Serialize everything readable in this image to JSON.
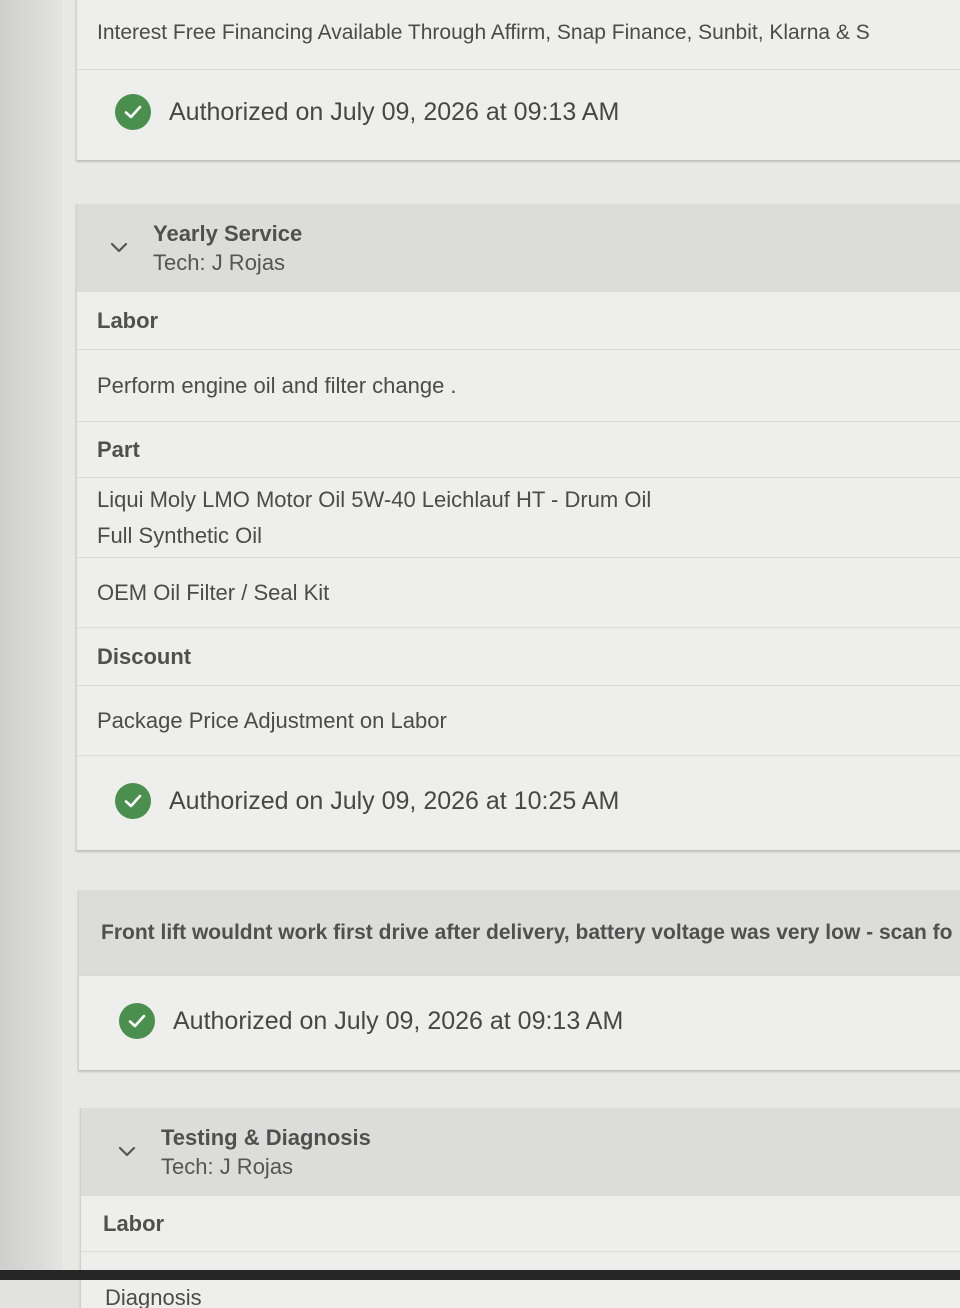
{
  "financing": {
    "text": "Interest Free Financing Available Through   Affirm,  Snap Finance, Sunbit, Klarna & S",
    "authorized": "Authorized on July 09, 2026 at 09:13 AM"
  },
  "yearly_service": {
    "title": "Yearly Service",
    "tech": "Tech: J Rojas",
    "labor_header": "Labor",
    "labor_item": "Perform engine oil and filter change .",
    "part_header": "Part",
    "part_items": [
      {
        "line1": "Liqui Moly LMO Motor Oil 5W-40 Leichlauf HT - Drum Oil",
        "line2": "Full Synthetic Oil"
      },
      {
        "line1": "OEM Oil Filter / Seal Kit"
      }
    ],
    "discount_header": "Discount",
    "discount_item": "Package Price Adjustment on Labor",
    "authorized": "Authorized on July 09, 2026 at 10:25 AM"
  },
  "front_lift": {
    "text": "Front lift wouldnt work first drive after delivery, battery voltage was very low - scan fo",
    "authorized": "Authorized on July 09, 2026 at 09:13 AM"
  },
  "testing_diagnosis": {
    "title": "Testing & Diagnosis",
    "tech": "Tech: J Rojas",
    "labor_header": "Labor",
    "next_item_partial": "Diagnosis"
  },
  "colors": {
    "check_green": "#4a8f4e",
    "header_gray": "#dcdddb",
    "card_bg": "#eeefed"
  }
}
